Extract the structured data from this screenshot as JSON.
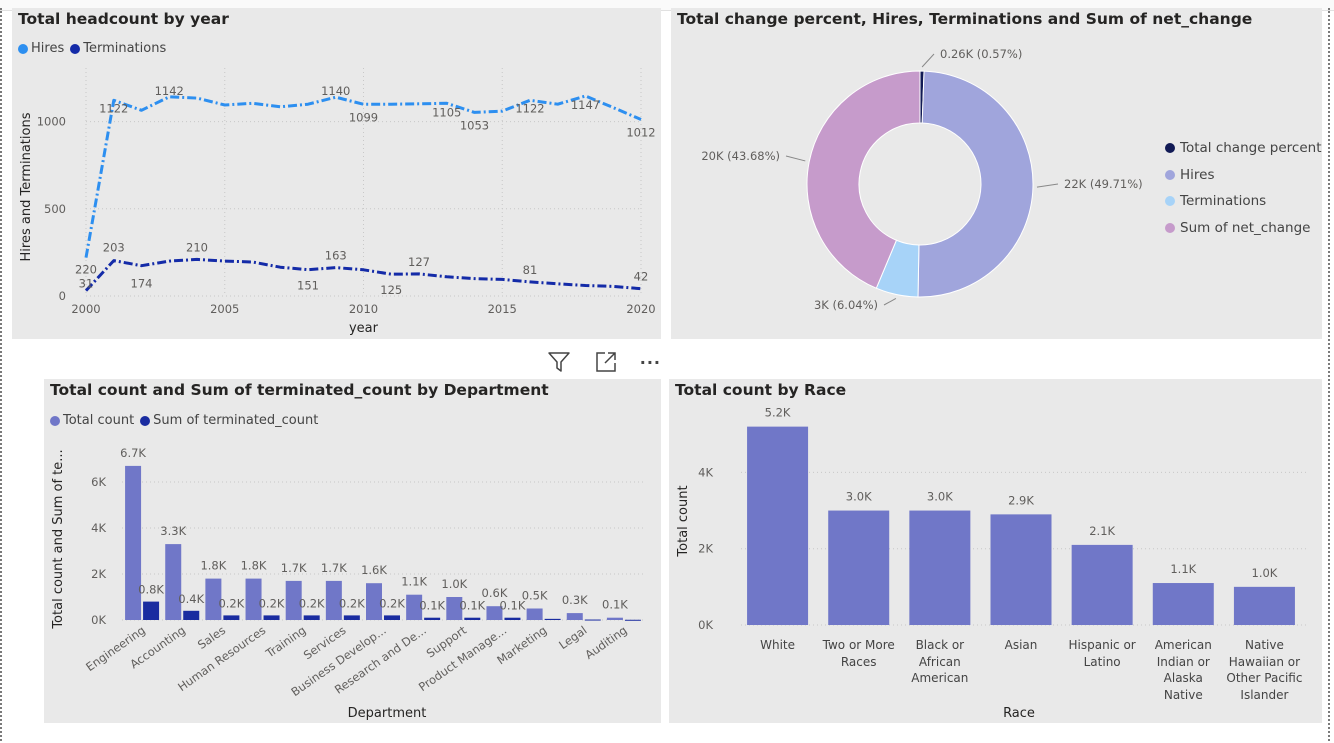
{
  "colors": {
    "hires": "#2d8ff0",
    "terminations": "#142ba8",
    "total_count": "#7077c8",
    "terminated_count": "#1a2ca0",
    "donut": [
      "#111a55",
      "#a0a5dc",
      "#a7d3f8",
      "#c69bcb"
    ],
    "panel_bg": "#e9e9e9"
  },
  "visual_header": {
    "icons": [
      "filter-icon",
      "focus-mode-icon",
      "more-options-icon"
    ],
    "more_label": "···"
  },
  "charts": [
    {
      "type": "line",
      "title": "Total headcount by year",
      "xlabel": "year",
      "ylabel": "Hires and Terminations",
      "xlim": [
        2000,
        2020
      ],
      "ylim": [
        0,
        1250
      ],
      "x_ticks": [
        "2000",
        "2005",
        "2010",
        "2015",
        "2020"
      ],
      "y_ticks": [
        "0",
        "500",
        "1000"
      ],
      "x": [
        2000,
        2001,
        2002,
        2003,
        2004,
        2005,
        2006,
        2007,
        2008,
        2009,
        2010,
        2011,
        2012,
        2013,
        2014,
        2015,
        2016,
        2017,
        2018,
        2019,
        2020
      ],
      "series": [
        {
          "name": "Hires",
          "values": [
            220,
            1122,
            1065,
            1142,
            1135,
            1095,
            1105,
            1085,
            1100,
            1140,
            1099,
            1100,
            1102,
            1105,
            1053,
            1060,
            1122,
            1100,
            1147,
            1080,
            1012
          ],
          "labels": [
            "220",
            "1122",
            "",
            "1142",
            "",
            "",
            "",
            "",
            "",
            "1140",
            "1099",
            "",
            "",
            "1105",
            "1053",
            "",
            "1122",
            "",
            "1147",
            "",
            "1012"
          ]
        },
        {
          "name": "Terminations",
          "values": [
            31,
            203,
            174,
            200,
            210,
            200,
            195,
            165,
            151,
            163,
            150,
            125,
            127,
            110,
            100,
            95,
            81,
            70,
            60,
            55,
            42
          ],
          "labels": [
            "31",
            "203",
            "174",
            "",
            "210",
            "",
            "",
            "",
            "151",
            "163",
            "",
            "125",
            "127",
            "",
            "",
            "",
            "81",
            "",
            "",
            "",
            "42"
          ]
        }
      ]
    },
    {
      "type": "pie",
      "title": "Total change percent, Hires, Terminations and Sum of net_change",
      "slices": [
        {
          "name": "Total change percent",
          "value": 0.26,
          "label": "0.26K (0.57%)"
        },
        {
          "name": "Hires",
          "value": 22,
          "label": "22K (49.71%)"
        },
        {
          "name": "Terminations",
          "value": 3,
          "label": "3K (6.04%)"
        },
        {
          "name": "Sum of net_change",
          "value": 20,
          "label": "20K (43.68%)"
        }
      ],
      "percents": [
        0.57,
        49.71,
        6.04,
        43.68
      ],
      "legend": "right"
    },
    {
      "type": "bar",
      "title": "Total count and Sum of terminated_count by Department",
      "xlabel": "Department",
      "ylabel": "Total count and Sum of te...",
      "ylim": [
        0,
        7000
      ],
      "y_ticks": [
        "0K",
        "2K",
        "4K",
        "6K"
      ],
      "categories": [
        "Engineering",
        "Accounting",
        "Sales",
        "Human Resources",
        "Training",
        "Services",
        "Business Develop...",
        "Research and De...",
        "Support",
        "Product Manage...",
        "Marketing",
        "Legal",
        "Auditing"
      ],
      "series": [
        {
          "name": "Total count",
          "values": [
            6700,
            3300,
            1800,
            1800,
            1700,
            1700,
            1600,
            1100,
            1000,
            600,
            500,
            300,
            100
          ],
          "labels": [
            "6.7K",
            "3.3K",
            "1.8K",
            "1.8K",
            "1.7K",
            "1.7K",
            "1.6K",
            "1.1K",
            "1.0K",
            "0.6K",
            "0.5K",
            "0.3K",
            "0.1K"
          ]
        },
        {
          "name": "Sum of terminated_count",
          "values": [
            800,
            400,
            200,
            200,
            200,
            200,
            200,
            100,
            100,
            100,
            50,
            20,
            10
          ],
          "labels": [
            "0.8K",
            "0.4K",
            "0.2K",
            "0.2K",
            "0.2K",
            "0.2K",
            "0.2K",
            "0.1K",
            "0.1K",
            "0.1K",
            "",
            "",
            ""
          ]
        }
      ]
    },
    {
      "type": "bar",
      "title": "Total count by Race",
      "xlabel": "Race",
      "ylabel": "Total count",
      "ylim": [
        0,
        5400
      ],
      "y_ticks": [
        "0K",
        "2K",
        "4K"
      ],
      "categories": [
        "White",
        "Two or More Races",
        "Black or African American",
        "Asian",
        "Hispanic or Latino",
        "American Indian or Alaska Native",
        "Native Hawaiian or Other Pacific Islander"
      ],
      "category_lines": [
        [
          "White"
        ],
        [
          "Two or More",
          "Races"
        ],
        [
          "Black or",
          "African",
          "American"
        ],
        [
          "Asian"
        ],
        [
          "Hispanic or",
          "Latino"
        ],
        [
          "American",
          "Indian or",
          "Alaska",
          "Native"
        ],
        [
          "Native",
          "Hawaiian or",
          "Other Pacific",
          "Islander"
        ]
      ],
      "series": [
        {
          "name": "Total count",
          "values": [
            5200,
            3000,
            3000,
            2900,
            2100,
            1100,
            1000
          ],
          "labels": [
            "5.2K",
            "3.0K",
            "3.0K",
            "2.9K",
            "2.1K",
            "1.1K",
            "1.0K"
          ]
        }
      ]
    }
  ]
}
